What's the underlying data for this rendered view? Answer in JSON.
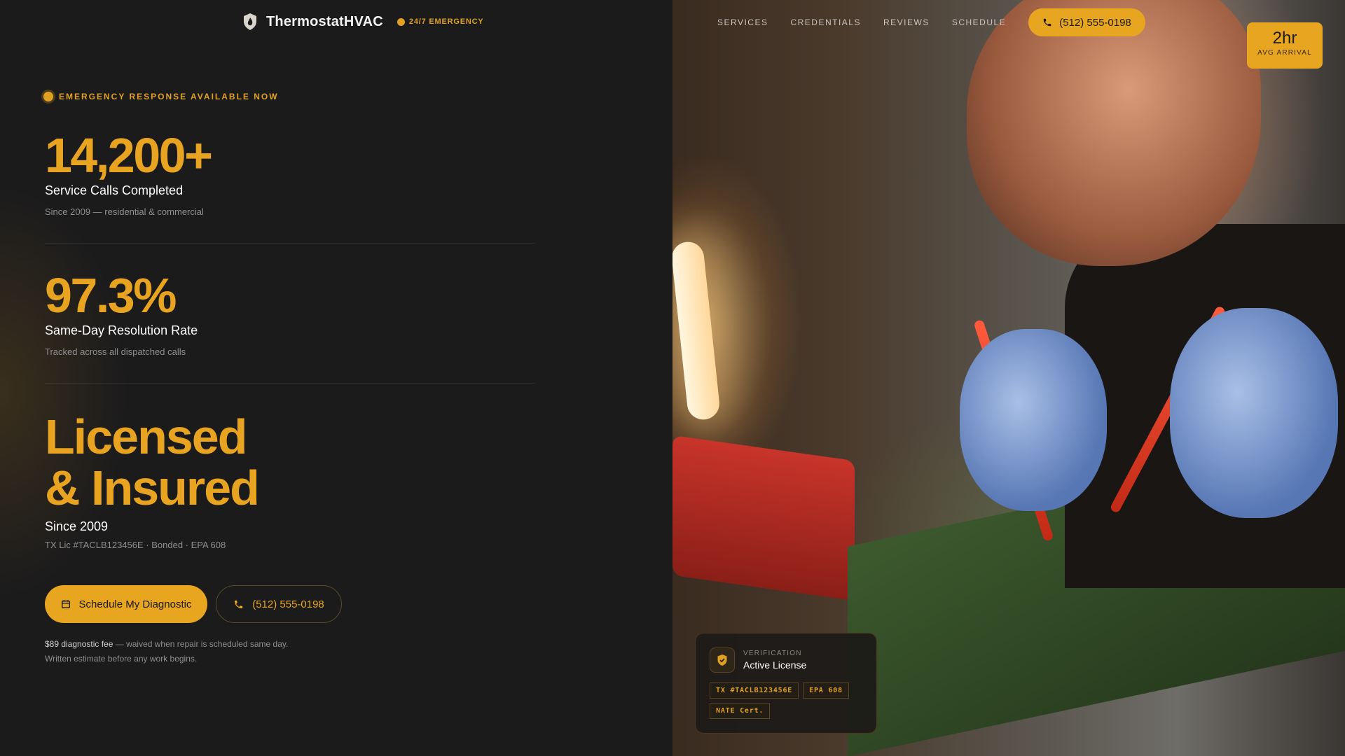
{
  "brand": {
    "name": "ThermostatHVAC",
    "emergency": "24/7 EMERGENCY",
    "logo_icon": "flame-shield-icon"
  },
  "nav": {
    "links": [
      "SERVICES",
      "CREDENTIALS",
      "REVIEWS",
      "SCHEDULE"
    ],
    "cta_phone": "(512) 555-0198"
  },
  "badge": {
    "value": "2hr",
    "label": "AVG ARRIVAL"
  },
  "hero": {
    "status": "EMERGENCY RESPONSE AVAILABLE NOW",
    "stats": [
      {
        "value": "14,200+",
        "label": "Service Calls Completed",
        "sub": "Since 2009 — residential & commercial"
      },
      {
        "value": "97.3%",
        "label": "Same-Day Resolution Rate",
        "sub": "Tracked across all dispatched calls"
      }
    ],
    "headline_line1": "Licensed",
    "headline_line2": "& Insured",
    "since": "Since 2009",
    "license_line": "TX Lic #TACLB123456E · Bonded · EPA 608",
    "primary_cta": "Schedule My Diagnostic",
    "secondary_cta": "(512) 555-0198",
    "fee_strong": "$89 diagnostic fee",
    "fee_rest": " — waived when repair is scheduled same day.",
    "fee_line2": "Written estimate before any work begins."
  },
  "verification": {
    "kicker": "VERIFICATION",
    "title": "Active License",
    "tags": [
      "TX #TACLB123456E",
      "EPA 608",
      "NATE Cert."
    ]
  },
  "colors": {
    "accent": "#e7a520",
    "background": "#1b1b1c",
    "muted": "#8f8f8f"
  }
}
